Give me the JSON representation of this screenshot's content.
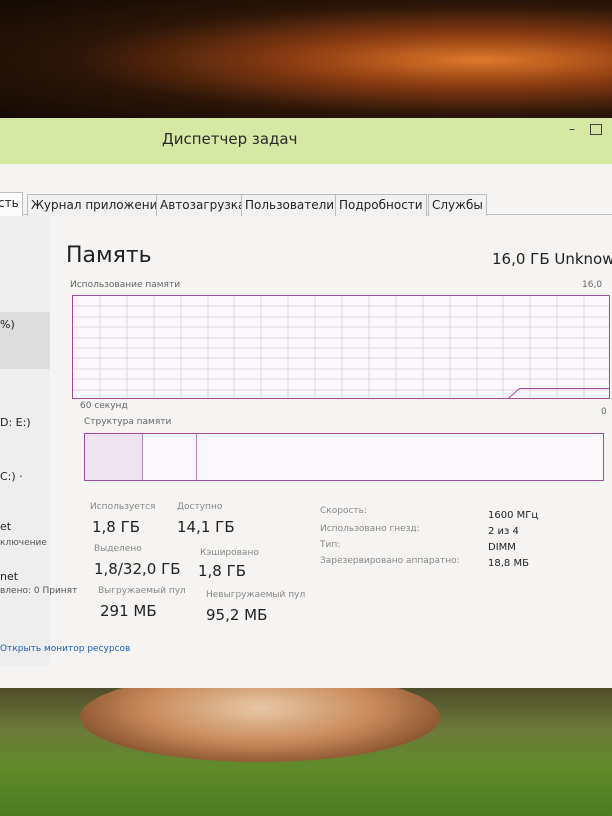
{
  "window": {
    "title": "Диспетчер задач"
  },
  "tabs": [
    {
      "label": "сть"
    },
    {
      "label": "Журнал приложений"
    },
    {
      "label": "Автозагрузка"
    },
    {
      "label": "Пользователи"
    },
    {
      "label": "Подробности"
    },
    {
      "label": "Службы"
    }
  ],
  "sidebar": {
    "items": [
      {
        "line1": "%)"
      },
      {
        "line1": "D: E:)"
      },
      {
        "line1": "C:) ·"
      },
      {
        "line1": "et",
        "line2": "ключение"
      },
      {
        "line1": "net",
        "line2": "влено: 0 Принят"
      }
    ]
  },
  "memory": {
    "title": "Память",
    "total_label": "16,0 ГБ Unknow",
    "usage_label": "Использование памяти",
    "usage_max": "16,0",
    "time_label": "60 секунд",
    "time_end": "0",
    "structure_label": "Структура памяти",
    "usage_fraction": 0.11
  },
  "stats": {
    "in_use_label": "Используется",
    "in_use_value": "1,8 ГБ",
    "available_label": "Доступно",
    "available_value": "14,1 ГБ",
    "committed_label": "Выделено",
    "committed_value": "1,8/32,0 ГБ",
    "cached_label": "Кэшировано",
    "cached_value": "1,8 ГБ",
    "paged_label": "Выгружаемый пул",
    "paged_value": "291 МБ",
    "nonpaged_label": "Невыгружаемый пул",
    "nonpaged_value": "95,2 МБ"
  },
  "details": {
    "speed_label": "Скорость:",
    "speed_value": "1600 МГц",
    "slots_label": "Использовано гнезд:",
    "slots_value": "2 из 4",
    "type_label": "Тип:",
    "type_value": "DIMM",
    "reserved_label": "Зарезервировано аппаратно:",
    "reserved_value": "18,8 МБ"
  },
  "footer": {
    "resource_monitor": "Открыть монитор ресурсов"
  },
  "colors": {
    "accent": "#b9d76a",
    "graph_border": "#a04ba0",
    "link": "#1a5fb4"
  }
}
